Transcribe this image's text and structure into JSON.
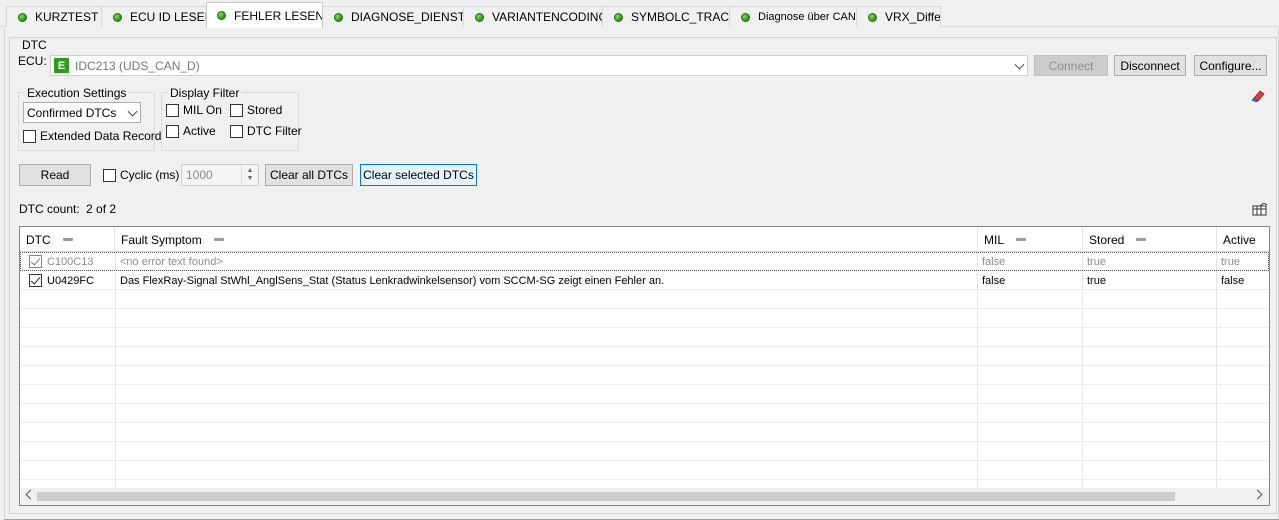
{
  "tabs": [
    {
      "label": "KURZTEST"
    },
    {
      "label": "ECU ID LESEN"
    },
    {
      "label": "FEHLER LESEN"
    },
    {
      "label": "DIAGNOSE_DIENSTE"
    },
    {
      "label": "VARIANTENCODING"
    },
    {
      "label": "SYMBOLC_TRACE"
    },
    {
      "label": "Diagnose über CAN"
    },
    {
      "label": "VRX_Differ"
    }
  ],
  "active_tab": "FEHLER LESEN",
  "panel": {
    "title": "DTC"
  },
  "ecu": {
    "label": "ECU:",
    "badge": "E",
    "selected": "IDC213 (UDS_CAN_D)",
    "connect_label": "Connect",
    "disconnect_label": "Disconnect",
    "configure_label": "Configure..."
  },
  "execution": {
    "title": "Execution Settings",
    "mode": "Confirmed DTCs",
    "extended_label": "Extended Data Record",
    "extended_checked": false
  },
  "display_filter": {
    "title": "Display Filter",
    "mil_on": "MIL On",
    "stored": "Stored",
    "active": "Active",
    "dtc_filter": "DTC Filter"
  },
  "actions": {
    "read_label": "Read",
    "cyclic_label": "Cyclic (ms)",
    "cyclic_value": "1000",
    "clear_all_label": "Clear all DTCs",
    "clear_selected_label": "Clear selected DTCs"
  },
  "dtc_count": {
    "label": "DTC count:",
    "value": "2 of 2"
  },
  "grid": {
    "columns": [
      "DTC",
      "Fault Symptom",
      "MIL",
      "Stored",
      "Active"
    ],
    "rows": [
      {
        "checked": true,
        "dtc": "C100C13",
        "symptom": "<no error text found>",
        "mil": "false",
        "stored": "true",
        "active": "true"
      },
      {
        "checked": true,
        "dtc": "U0429FC",
        "symptom": "Das FlexRay-Signal StWhl_AnglSens_Stat (Status Lenkradwinkelsensor) vom SCCM-SG zeigt einen Fehler an.",
        "mil": "false",
        "stored": "true",
        "active": "false"
      }
    ]
  },
  "colors": {
    "led": "#3aa51a",
    "badge": "#2e9b1f",
    "highlight": "#0078d7"
  }
}
